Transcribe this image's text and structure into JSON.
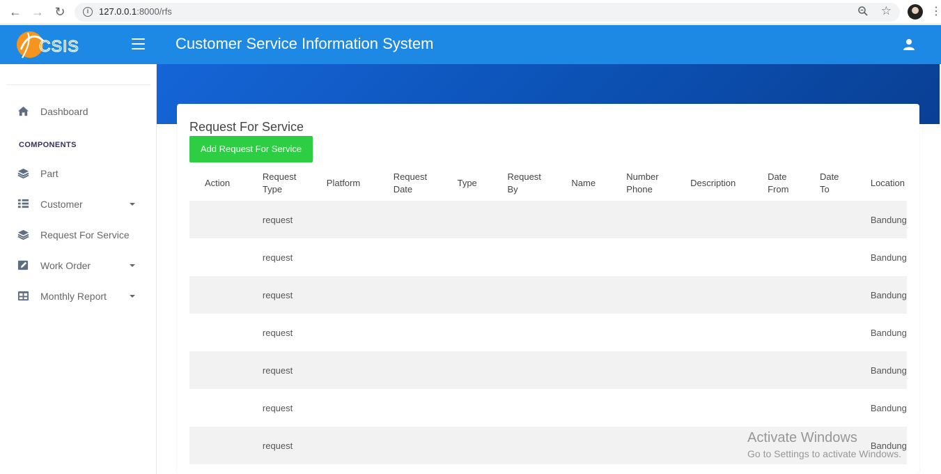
{
  "browser": {
    "url_host": "127.0.0.1",
    "url_path": ":8000/rfs"
  },
  "sidebar": {
    "items": [
      {
        "label": "Dashboard",
        "icon": "home-icon"
      },
      {
        "label": "Part",
        "icon": "layers-icon"
      },
      {
        "label": "Customer",
        "icon": "list-icon",
        "has_dropdown": true
      },
      {
        "label": "Request For Service",
        "icon": "layers-icon"
      },
      {
        "label": "Work Order",
        "icon": "edit-icon",
        "has_dropdown": true
      },
      {
        "label": "Monthly Report",
        "icon": "table-icon",
        "has_dropdown": true
      }
    ],
    "section_heading": "COMPONENTS"
  },
  "header": {
    "title": "Customer Service Information System"
  },
  "colors": {
    "primary": "#1E88E5",
    "success": "#2dce43"
  },
  "main": {
    "card_title": "Request For Service",
    "add_button_label": "Add Request For Service",
    "table": {
      "columns": [
        {
          "line1": "Action",
          "line2": ""
        },
        {
          "line1": "Request",
          "line2": "Type"
        },
        {
          "line1": "Platform",
          "line2": ""
        },
        {
          "line1": "Request",
          "line2": "Date"
        },
        {
          "line1": "Type",
          "line2": ""
        },
        {
          "line1": "Request",
          "line2": "By"
        },
        {
          "line1": "Name",
          "line2": ""
        },
        {
          "line1": "Number",
          "line2": "Phone"
        },
        {
          "line1": "Description",
          "line2": ""
        },
        {
          "line1": "Date",
          "line2": "From"
        },
        {
          "line1": "Date",
          "line2": "To"
        },
        {
          "line1": "Location",
          "line2": ""
        }
      ],
      "rows": [
        {
          "request_type": "request",
          "location": "Bandung"
        },
        {
          "request_type": "request",
          "location": "Bandung"
        },
        {
          "request_type": "request",
          "location": "Bandung"
        },
        {
          "request_type": "request",
          "location": "Bandung"
        },
        {
          "request_type": "request",
          "location": "Bandung"
        },
        {
          "request_type": "request",
          "location": "Bandung"
        },
        {
          "request_type": "request",
          "location": "Bandung"
        }
      ]
    }
  },
  "watermark": {
    "line1": "Activate Windows",
    "line2": "Go to Settings to activate Windows."
  }
}
